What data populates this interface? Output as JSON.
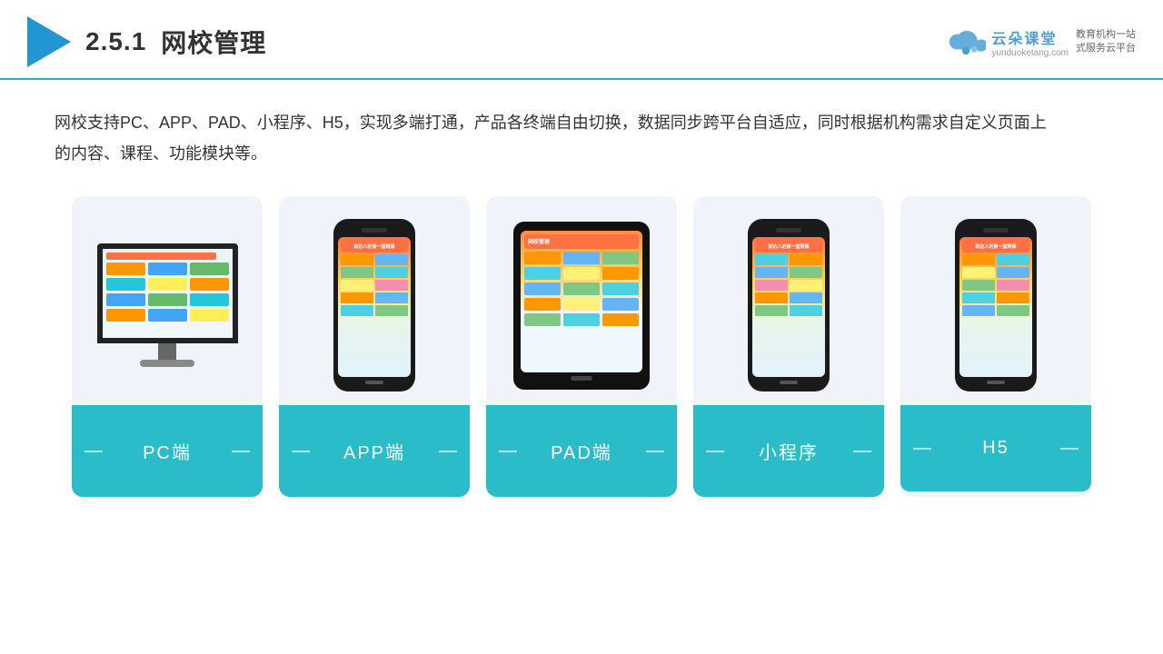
{
  "header": {
    "section_number": "2.5.1",
    "title": "网校管理",
    "brand": {
      "name": "云朵课堂",
      "url": "yunduoketang.com",
      "tagline": "教育机构一站\n式服务云平台"
    }
  },
  "description": "网校支持PC、APP、PAD、小程序、H5，实现多端打通，产品各终端自由切换，数据同步跨平台自适应，同时根据机构需求自定义页面上的内容、课程、功能模块等。",
  "devices": [
    {
      "id": "pc",
      "label": "PC端",
      "type": "monitor"
    },
    {
      "id": "app",
      "label": "APP端",
      "type": "phone"
    },
    {
      "id": "pad",
      "label": "PAD端",
      "type": "tablet"
    },
    {
      "id": "miniprogram",
      "label": "小程序",
      "type": "phone"
    },
    {
      "id": "h5",
      "label": "H5",
      "type": "phone"
    }
  ],
  "colors": {
    "accent": "#2bbcca",
    "header_border": "#1cb8c8",
    "card_bg": "#eef2fa",
    "title_color": "#333333",
    "brand_blue": "#4a9fd4"
  }
}
